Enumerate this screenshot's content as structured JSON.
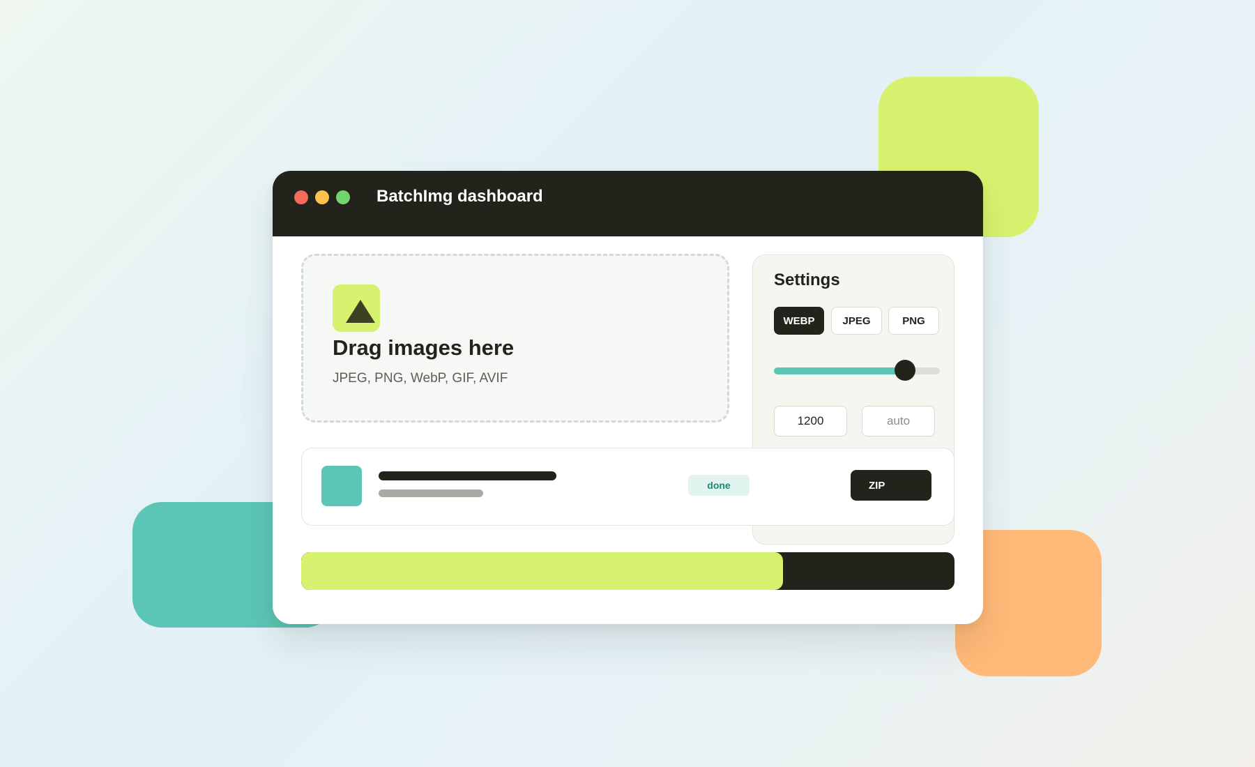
{
  "colors": {
    "lime": "#d6f26e",
    "teal": "#5cc6b6",
    "orange": "#ffb978",
    "dark": "#22231b",
    "traffic_red": "#f26b5e",
    "traffic_yellow": "#fbc34e",
    "traffic_green": "#72d46a"
  },
  "window": {
    "title": "BatchImg dashboard"
  },
  "dropzone": {
    "icon": "upload-triangle-icon",
    "title": "Drag images here",
    "subtitle": "JPEG, PNG, WebP, GIF, AVIF"
  },
  "settings": {
    "title": "Settings",
    "formats": [
      "WEBP",
      "JPEG",
      "PNG"
    ],
    "selected_format": "WEBP",
    "quality_fraction": 0.79,
    "width_value": "1200",
    "height_placeholder": "auto"
  },
  "file": {
    "status": "done",
    "zip_label": "ZIP"
  },
  "progress": {
    "fraction": 0.737
  }
}
